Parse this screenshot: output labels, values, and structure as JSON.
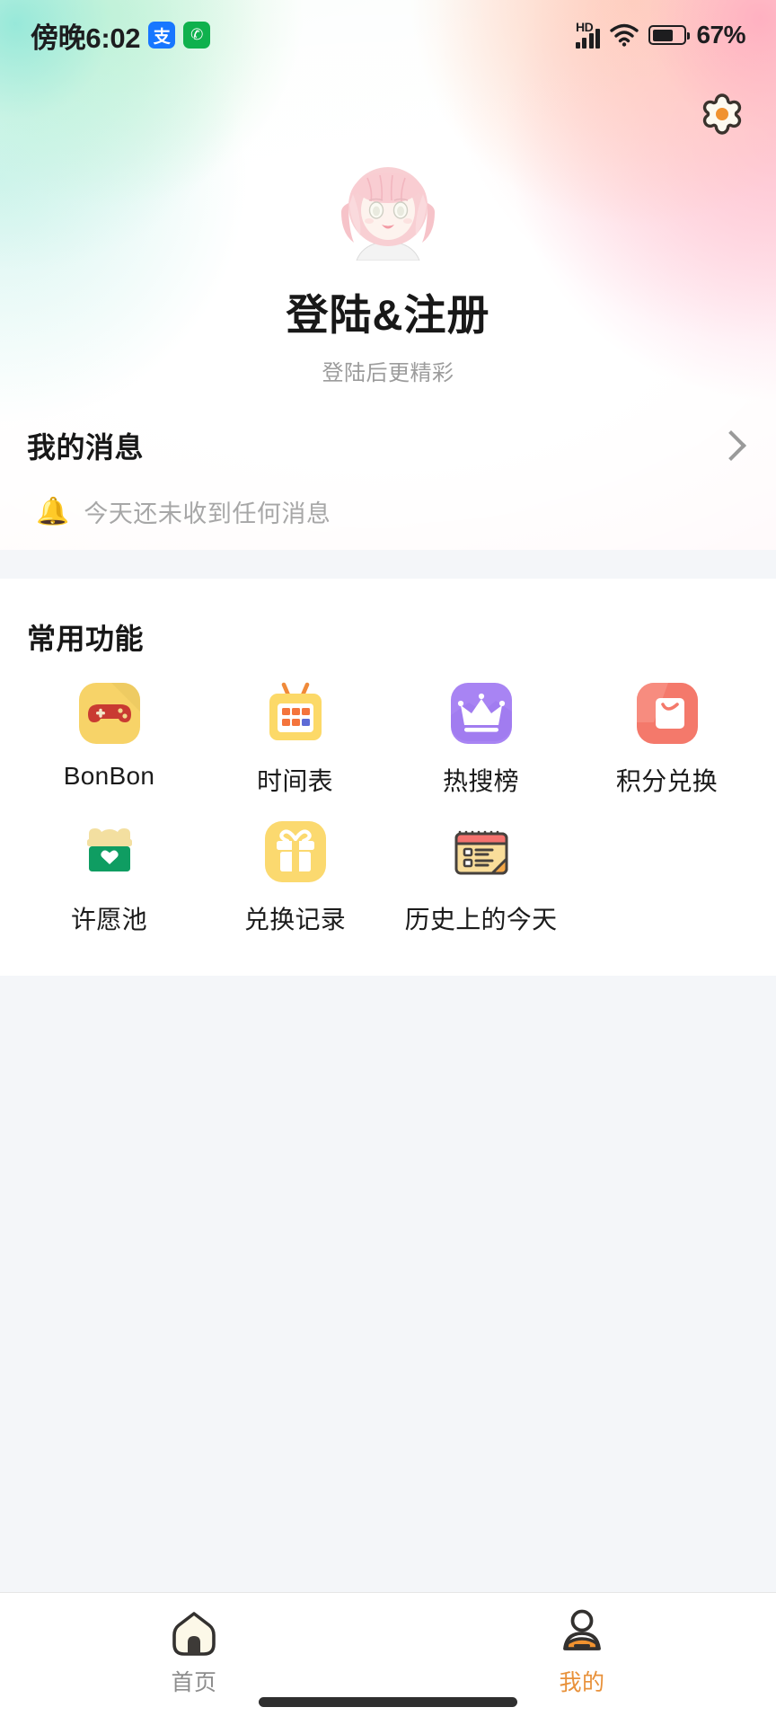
{
  "status_bar": {
    "time": "傍晚6:02",
    "alipay_badge": "支",
    "phone_badge": "✆",
    "network_type": "HD",
    "battery_percent": "67%",
    "battery_level": 67
  },
  "header": {
    "settings_icon": "gear-icon",
    "accent_color": "#f0922f"
  },
  "profile": {
    "avatar_icon": "anime-girl-avatar",
    "title": "登陆&注册",
    "subtitle": "登陆后更精彩"
  },
  "messages": {
    "title": "我的消息",
    "chevron_icon": "chevron-right-icon",
    "bell_icon": "🔔",
    "empty_text": "今天还未收到任何消息"
  },
  "functions": {
    "title": "常用功能",
    "items": [
      {
        "label": "BonBon",
        "icon": "gamepad-icon",
        "bg": "#f6d26a"
      },
      {
        "label": "时间表",
        "icon": "calendar-grid-icon",
        "bg": "#fbd96f"
      },
      {
        "label": "热搜榜",
        "icon": "crown-icon",
        "bg": "#a884f3"
      },
      {
        "label": "积分兑换",
        "icon": "shopping-bag-icon",
        "bg": "#f4796b"
      },
      {
        "label": "许愿池",
        "icon": "wish-box-icon",
        "bg": "#0f9d62"
      },
      {
        "label": "兑换记录",
        "icon": "gift-icon",
        "bg": "#fbd96f"
      },
      {
        "label": "历史上的今天",
        "icon": "history-calendar-icon",
        "bg": "#f6c26a"
      }
    ]
  },
  "bottom_nav": {
    "items": [
      {
        "label": "首页",
        "icon": "home-icon",
        "active": false
      },
      {
        "label": "我的",
        "icon": "person-icon",
        "active": true
      }
    ],
    "active_color": "#e8913a",
    "inactive_color": "#8d8d8d"
  }
}
